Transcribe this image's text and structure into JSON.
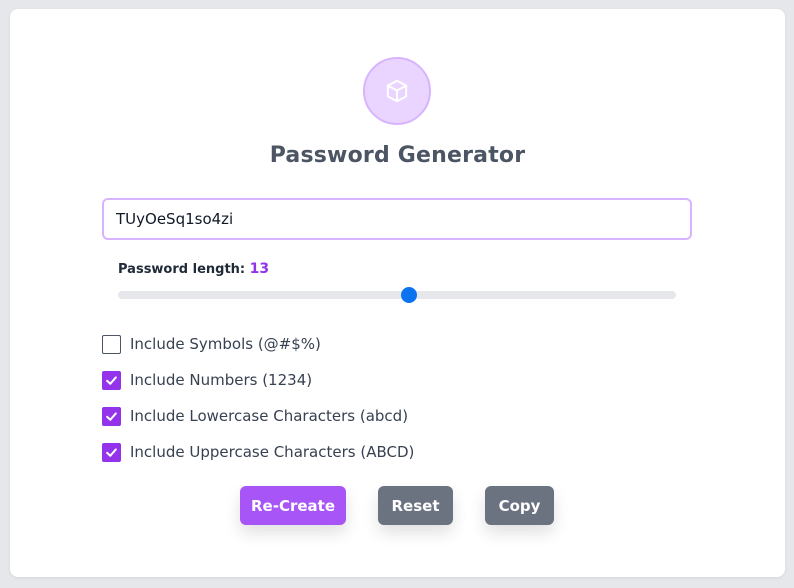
{
  "app": {
    "title": "Password Generator",
    "logo_icon": "cube-icon",
    "accent_color": "#a855f7"
  },
  "password": {
    "value": "TUyOeSq1so4zi"
  },
  "length": {
    "label": "Password length: ",
    "value": "13",
    "min": 1,
    "max": 24
  },
  "options": [
    {
      "label": "Include Symbols (@#$%)",
      "checked": false
    },
    {
      "label": "Include Numbers (1234)",
      "checked": true
    },
    {
      "label": "Include Lowercase Characters (abcd)",
      "checked": true
    },
    {
      "label": "Include Uppercase Characters (ABCD)",
      "checked": true
    }
  ],
  "buttons": {
    "recreate": "Re-Create",
    "reset": "Reset",
    "copy": "Copy"
  }
}
